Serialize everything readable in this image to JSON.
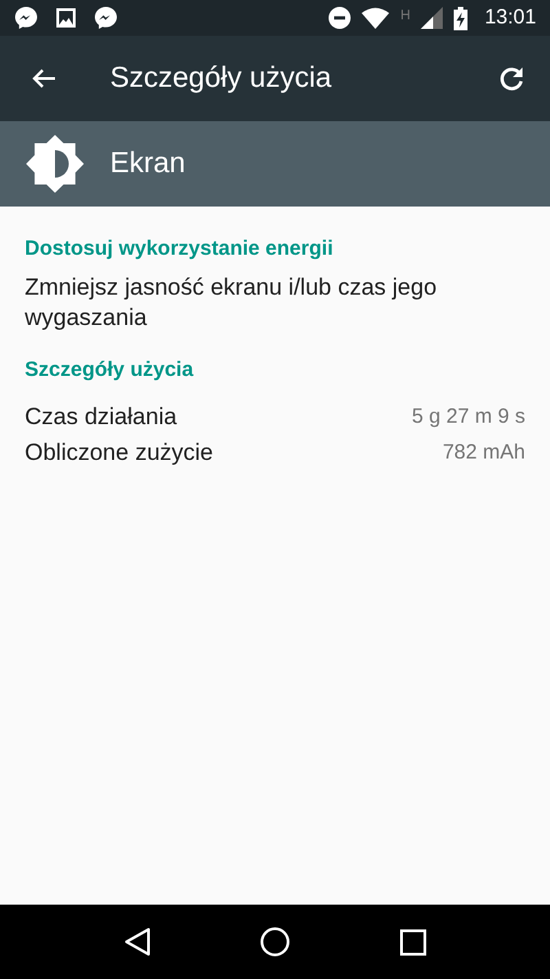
{
  "status_bar": {
    "network_type": "H",
    "time": "13:01"
  },
  "toolbar": {
    "title": "Szczegóły użycia"
  },
  "header": {
    "title": "Ekran"
  },
  "sections": [
    {
      "title": "Dostosuj wykorzystanie energii",
      "kind": "text",
      "body": "Zmniejsz jasność ekranu i/lub czas jego wygaszania"
    },
    {
      "title": "Szczegóły użycia",
      "kind": "rows",
      "rows": [
        {
          "label": "Czas działania",
          "value": "5 g 27 m 9 s"
        },
        {
          "label": "Obliczone zużycie",
          "value": "782 mAh"
        }
      ]
    }
  ]
}
